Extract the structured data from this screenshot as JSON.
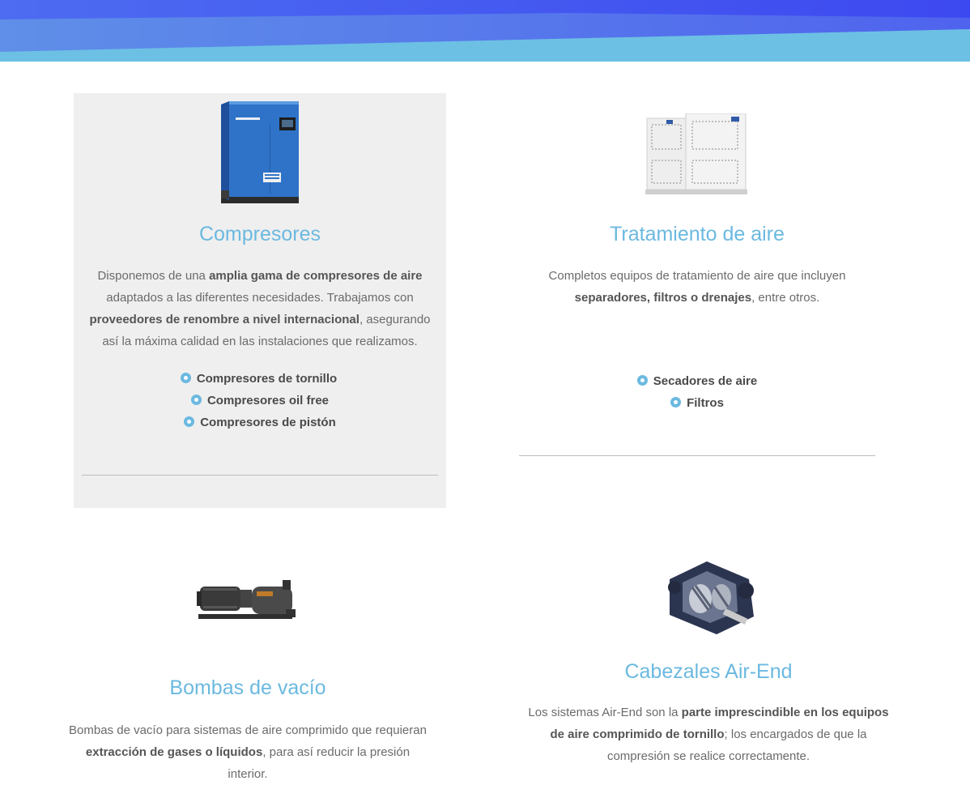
{
  "colors": {
    "accent": "#6bb9e0",
    "banner_dark": "#3f5bef",
    "banner_light": "#6ac1e3",
    "card_active_bg": "#efefef"
  },
  "products": [
    {
      "title": "Compresores",
      "image": "screw-air-compressor-image",
      "description": [
        {
          "text": "Disponemos de una ",
          "bold": false
        },
        {
          "text": "amplia gama de compresores de aire",
          "bold": true
        },
        {
          "text": " adaptados a las diferentes necesidades. Trabajamos con ",
          "bold": false
        },
        {
          "text": "proveedores de renombre a nivel internacional",
          "bold": true
        },
        {
          "text": ", asegurando así la máxima calidad en las instalaciones que realizamos.",
          "bold": false
        }
      ],
      "items": [
        "Compresores de tornillo",
        "Compresores oil free",
        "Compresores de pistón"
      ]
    },
    {
      "title": "Tratamiento de aire",
      "image": "air-dryer-units-image",
      "description": [
        {
          "text": "Completos equipos de tratamiento de aire que incluyen ",
          "bold": false
        },
        {
          "text": "separadores, filtros o drenajes",
          "bold": true
        },
        {
          "text": ", entre otros.",
          "bold": false
        }
      ],
      "items": [
        "Secadores de aire",
        "Filtros"
      ]
    },
    {
      "title": "Bombas de vacío",
      "image": "vacuum-pump-image",
      "description": [
        {
          "text": "Bombas de vacío para sistemas de aire comprimido que requieran ",
          "bold": false
        },
        {
          "text": "extracción de gases o líquidos",
          "bold": true
        },
        {
          "text": ", para así reducir la presión interior.",
          "bold": false
        }
      ],
      "items": []
    },
    {
      "title": "Cabezales Air-End",
      "image": "air-end-screw-head-image",
      "description": [
        {
          "text": "Los sistemas Air-End son la ",
          "bold": false
        },
        {
          "text": "parte imprescindible en los equipos de aire comprimido de tornillo",
          "bold": true
        },
        {
          "text": "; los encargados de que la compresión se realice correctamente.",
          "bold": false
        }
      ],
      "items": []
    }
  ]
}
